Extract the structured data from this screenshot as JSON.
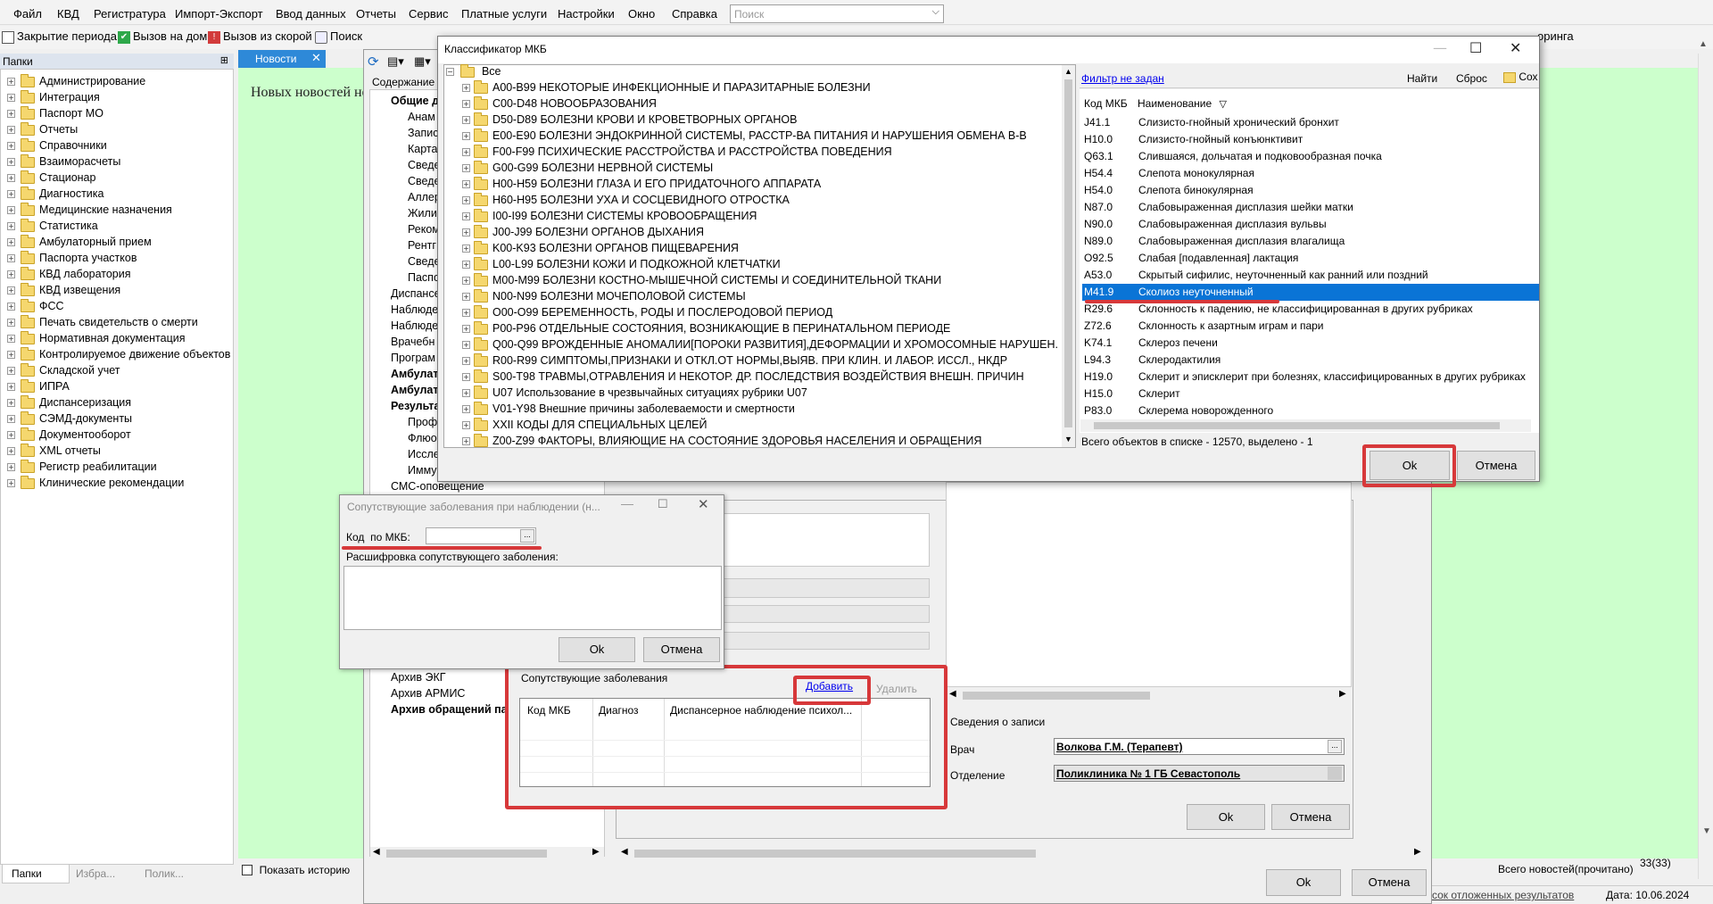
{
  "menu": [
    "Файл",
    "КВД",
    "Регистратура",
    "Импорт-Экспорт",
    "Ввод данных",
    "Отчеты",
    "Сервис",
    "Платные услуги",
    "Настройки",
    "Окно",
    "Справка"
  ],
  "search_placeholder": "Поиск",
  "toolbar": [
    "Закрытие периода",
    "Вызов на дом",
    "Вызов из скорой",
    "Поиск"
  ],
  "toolbar_right_text": "оринга",
  "left_panel": {
    "title": "Папки",
    "items": [
      "Администрирование",
      "Интеграция",
      "Паспорт МО",
      "Отчеты",
      "Справочники",
      "Взаиморасчеты",
      "Стационар",
      "Диагностика",
      "Медицинские назначения",
      "Статистика",
      "Амбулаторный прием",
      "Паспорта участков",
      "КВД лаборатория",
      "КВД извещения",
      "ФСС",
      "Печать свидетельств о смерти",
      "Нормативная документация",
      "Контролируемое движение объектов",
      "Складской учет",
      "ИПРА",
      "Диспансеризация",
      "СЭМД-документы",
      "Документооборот",
      "XML отчеты",
      "Регистр реабилитации",
      "Клинические рекомендации"
    ],
    "tabs": [
      "Папки",
      "Избра...",
      "Полик..."
    ]
  },
  "news": {
    "tab": "Новости",
    "heading": "Новых новостей не",
    "show_history": "Показать историю",
    "total": "Всего новостей(прочитано)",
    "count": "33(33)"
  },
  "bg_window": {
    "content_label": "Содержание",
    "tree_items": [
      "Общие д",
      "Анам",
      "Запис",
      "Карта",
      "Сведе",
      "Сведе",
      "Аллер",
      "Жили",
      "Реком",
      "Рентг",
      "Сведе",
      "Паспо",
      "Диспансе",
      "Наблюде",
      "Наблюде",
      "Врачебн",
      "Програм",
      "Амбулат",
      "Амбулат",
      "Результа",
      "Проф",
      "Флюо",
      "Иссле",
      "Имму",
      "СМС-оповещение",
      "Архив ЭКГ",
      "Архив АРМИС",
      "Архив обращений пац"
    ],
    "record_info": "Сведения о записи",
    "doctor_label": "Врач",
    "doctor_value": "Волкова Г.М. (Терапевт)",
    "dept_label": "Отделение",
    "dept_value": "Поликлиника № 1 ГБ Севастополь",
    "ok": "Ok",
    "cancel": "Отмена"
  },
  "concomitant_panel": {
    "title": "Сопутствующие заболевания",
    "add": "Добавить",
    "delete": "Удалить",
    "columns": [
      "Код МКБ",
      "Диагноз",
      "Диспансерное наблюдение психол..."
    ]
  },
  "small_dialog": {
    "title": "Сопутствующие заболевания при наблюдении (н...",
    "code_label": "Код  по МКБ:",
    "decode_label": "Расшифровка сопутствующего заболения:",
    "ok": "Ok",
    "cancel": "Отмена"
  },
  "mkb_dialog": {
    "title": "Классификатор МКБ",
    "root": "Все",
    "tree": [
      "A00-B99 НЕКОТОРЫЕ ИНФЕКЦИОННЫЕ И ПАРАЗИТАРНЫЕ БОЛЕЗНИ",
      "C00-D48 НОВООБРАЗОВАНИЯ",
      "D50-D89 БОЛЕЗНИ КРОВИ И КРОВЕТВОРНЫХ ОРГАНОВ",
      "E00-E90 БОЛЕЗНИ ЭНДОКРИННОЙ СИСТЕМЫ, РАССТР-ВА ПИТАНИЯ И НАРУШЕНИЯ ОБМЕНА В-В",
      "F00-F99 ПСИХИЧЕСКИЕ РАССТРОЙСТВА И РАССТРОЙСТВА ПОВЕДЕНИЯ",
      "G00-G99 БОЛЕЗНИ НЕРВНОЙ СИСТЕМЫ",
      "H00-H59 БОЛЕЗНИ ГЛАЗА И ЕГО ПРИДАТОЧНОГО АППАРАТА",
      "H60-H95 БОЛЕЗНИ УХА И СОСЦЕВИДНОГО ОТРОСТКА",
      "I00-I99 БОЛЕЗНИ СИСТЕМЫ КРОВООБРАЩЕНИЯ",
      "J00-J99 БОЛЕЗНИ ОРГАНОВ ДЫХАНИЯ",
      "K00-K93 БОЛЕЗНИ ОРГАНОВ ПИЩЕВАРЕНИЯ",
      "L00-L99 БОЛЕЗНИ КОЖИ И ПОДКОЖНОЙ КЛЕТЧАТКИ",
      "M00-M99 БОЛЕЗНИ КОСТНО-МЫШЕЧНОЙ СИСТЕМЫ И СОЕДИНИТЕЛЬНОЙ ТКАНИ",
      "N00-N99 БОЛЕЗНИ МОЧЕПОЛОВОЙ СИСТЕМЫ",
      "O00-O99 БЕРЕМЕННОСТЬ, РОДЫ И ПОСЛЕРОДОВОЙ ПЕРИОД",
      "P00-P96 ОТДЕЛЬНЫЕ СОСТОЯНИЯ, ВОЗНИКАЮЩИЕ В ПЕРИНАТАЛЬНОМ ПЕРИОДЕ",
      "Q00-Q99 ВРОЖДЕННЫЕ АНОМАЛИИ[ПОРОКИ РАЗВИТИЯ],ДЕФОРМАЦИИ И ХРОМОСОМНЫЕ НАРУШЕН.",
      "R00-R99 СИМПТОМЫ,ПРИЗНАКИ И ОТКЛ.ОТ НОРМЫ,ВЫЯВ. ПРИ КЛИН. И ЛАБОР. ИССЛ., НКДР",
      "S00-T98 ТРАВМЫ,ОТРАВЛЕНИЯ И НЕКОТОР. ДР. ПОСЛЕДСТВИЯ ВОЗДЕЙСТВИЯ ВНЕШН. ПРИЧИН",
      "U07 Использование в чрезвычайных ситуациях рубрики U07",
      "V01-Y98 Внешние причины заболеваемости и смертности",
      "XXII КОДЫ ДЛЯ СПЕЦИАЛЬНЫХ ЦЕЛЕЙ",
      "Z00-Z99 ФАКТОРЫ, ВЛИЯЮЩИЕ НА СОСТОЯНИЕ ЗДОРОВЬЯ НАСЕЛЕНИЯ И ОБРАЩЕНИЯ"
    ],
    "filter": "Фильтр не задан",
    "find": "Найти",
    "reset": "Сброс",
    "save": "Сох",
    "col_code": "Код МКБ",
    "col_name": "Наименование",
    "rows": [
      {
        "code": "J41.1",
        "name": "Слизисто-гнойный хронический бронхит"
      },
      {
        "code": "H10.0",
        "name": "Слизисто-гнойный конъюнктивит"
      },
      {
        "code": "Q63.1",
        "name": "Слившаяся, дольчатая и подковообразная почка"
      },
      {
        "code": "H54.4",
        "name": "Слепота монокулярная"
      },
      {
        "code": "H54.0",
        "name": "Слепота бинокулярная"
      },
      {
        "code": "N87.0",
        "name": "Слабовыраженная дисплазия шейки матки"
      },
      {
        "code": "N90.0",
        "name": "Слабовыраженная дисплазия вульвы"
      },
      {
        "code": "N89.0",
        "name": "Слабовыраженная дисплазия влагалища"
      },
      {
        "code": "O92.5",
        "name": "Слабая [подавленная] лактация"
      },
      {
        "code": "A53.0",
        "name": "Скрытый сифилис, неуточненный как ранний или поздний"
      },
      {
        "code": "M41.9",
        "name": "Сколиоз неуточненный"
      },
      {
        "code": "R29.6",
        "name": "Склонность к падению, не классифицированная в других рубриках"
      },
      {
        "code": "Z72.6",
        "name": "Склонность к азартным играм и пари"
      },
      {
        "code": "K74.1",
        "name": "Склероз печени"
      },
      {
        "code": "L94.3",
        "name": "Склеродактилия"
      },
      {
        "code": "H19.0",
        "name": "Склерит и эписклерит при болезнях, классифицированных в других рубриках"
      },
      {
        "code": "H15.0",
        "name": "Склерит"
      },
      {
        "code": "P83.0",
        "name": "Склерема новорожденного"
      }
    ],
    "status": "Всего объектов в списке - 12570, выделено - 1",
    "ok": "Ok",
    "cancel": "Отмена"
  },
  "bottom_buttons": {
    "ok": "Ok",
    "cancel": "Отмена"
  },
  "statusbar": {
    "deferred": "сок отложенных результатов",
    "date": "Дата: 10.06.2024"
  }
}
